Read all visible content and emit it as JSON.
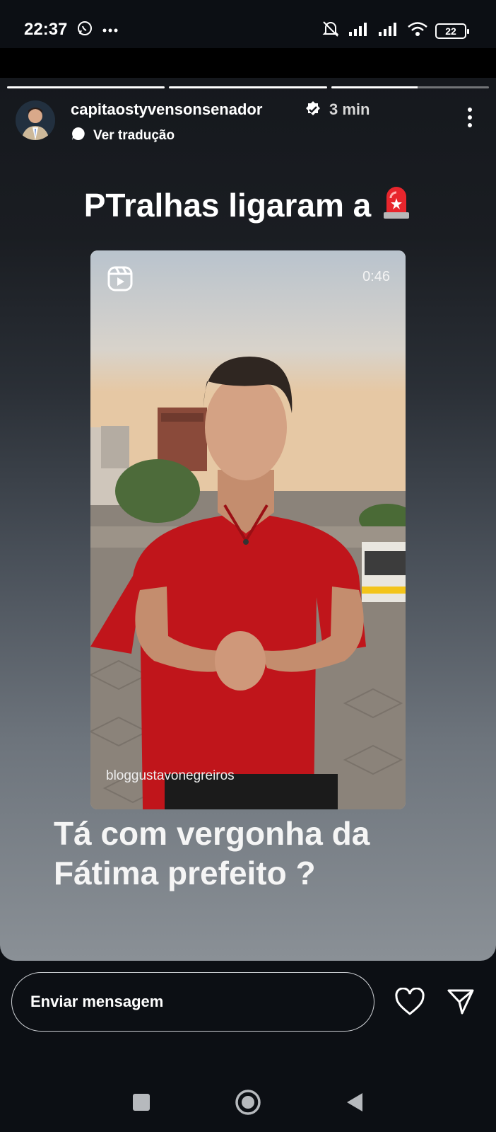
{
  "status_bar": {
    "time": "22:37",
    "battery": "22"
  },
  "story": {
    "username": "capitaostyvensonsenador",
    "time_ago": "3 min",
    "translate_label": "Ver tradução",
    "headline": "PTralhas ligaram a",
    "headline_emoji": "🚨",
    "video": {
      "duration": "0:46",
      "watermark": "bloggustavonegreiros"
    },
    "caption_line1": "Tá com vergonha da",
    "caption_line2": "Fátima prefeito ?",
    "progress": [
      1,
      1,
      0.55
    ]
  },
  "reply": {
    "placeholder": "Enviar mensagem"
  },
  "colors": {
    "accent": "#ffffff",
    "background": "#0c0f14",
    "shirt": "#c0151b"
  },
  "icons": [
    "whatsapp-icon",
    "more-dots-icon",
    "mute-icon",
    "signal-icon",
    "wifi-icon",
    "battery-icon",
    "verified-icon",
    "translate-icon",
    "reel-icon",
    "heart-icon",
    "send-icon",
    "recent-apps-icon",
    "home-icon",
    "back-icon"
  ]
}
